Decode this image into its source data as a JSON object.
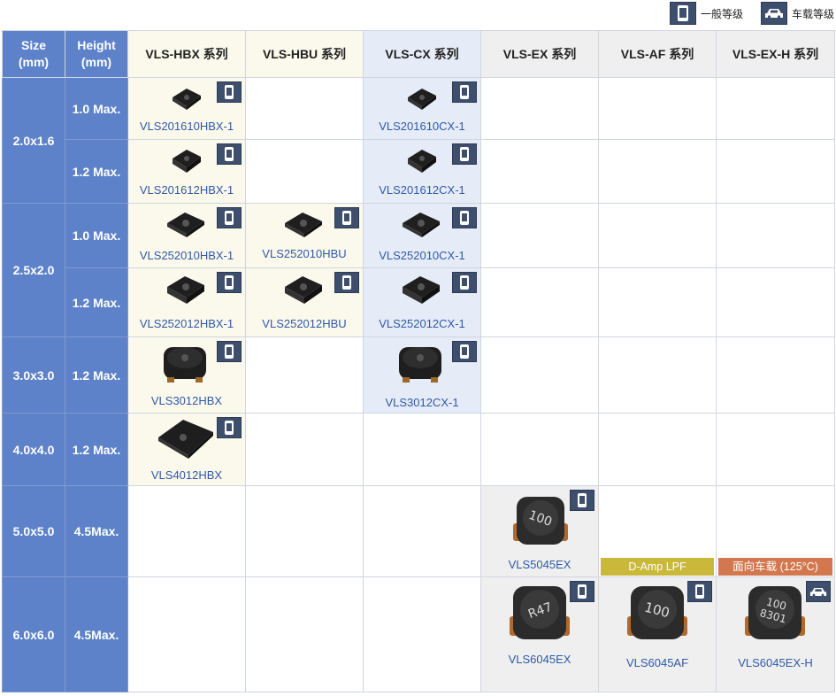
{
  "legend": {
    "general": "一般等级",
    "automotive": "车载等级"
  },
  "header": {
    "size": "Size\n(mm)",
    "height": "Height\n(mm)",
    "series": [
      "VLS-HBX 系列",
      "VLS-HBU 系列",
      "VLS-CX 系列",
      "VLS-EX 系列",
      "VLS-AF 系列",
      "VLS-EX-H 系列"
    ]
  },
  "rows": [
    {
      "size": "2.0x1.6",
      "heights": [
        "1.0 Max.",
        "1.2 Max."
      ]
    },
    {
      "size": "2.5x2.0",
      "heights": [
        "1.0 Max.",
        "1.2 Max."
      ]
    },
    {
      "size": "3.0x3.0",
      "heights": [
        "1.2 Max."
      ]
    },
    {
      "size": "4.0x4.0",
      "heights": [
        "1.2 Max."
      ]
    },
    {
      "size": "5.0x5.0",
      "heights": [
        "4.5Max."
      ]
    },
    {
      "size": "6.0x6.0",
      "heights": [
        "4.5Max."
      ]
    }
  ],
  "products": {
    "p1": "VLS201610HBX-1",
    "p2": "VLS201610CX-1",
    "p3": "VLS201612HBX-1",
    "p4": "VLS201612CX-1",
    "p5": "VLS252010HBX-1",
    "p6": "VLS252010HBU",
    "p7": "VLS252010CX-1",
    "p8": "VLS252012HBX-1",
    "p9": "VLS252012HBU",
    "p10": "VLS252012CX-1",
    "p11": "VLS3012HBX",
    "p12": "VLS3012CX-1",
    "p13": "VLS4012HBX",
    "p14": "VLS5045EX",
    "p15": "VLS6045EX",
    "p16": "VLS6045AF",
    "p17": "VLS6045EX-H"
  },
  "chip_marks": {
    "m14": "100",
    "m15": "R47",
    "m16": "100",
    "m17a": "100",
    "m17b": "8301"
  },
  "tags": {
    "af": "D-Amp LPF",
    "exh": "面向车载 (125°C)"
  },
  "grade_icons": {
    "general": "smartphone-icon",
    "automotive": "car-icon"
  },
  "colors": {
    "size_column": "#5d82c9",
    "badge": "#3e4f6d",
    "link": "#2f58a8"
  }
}
